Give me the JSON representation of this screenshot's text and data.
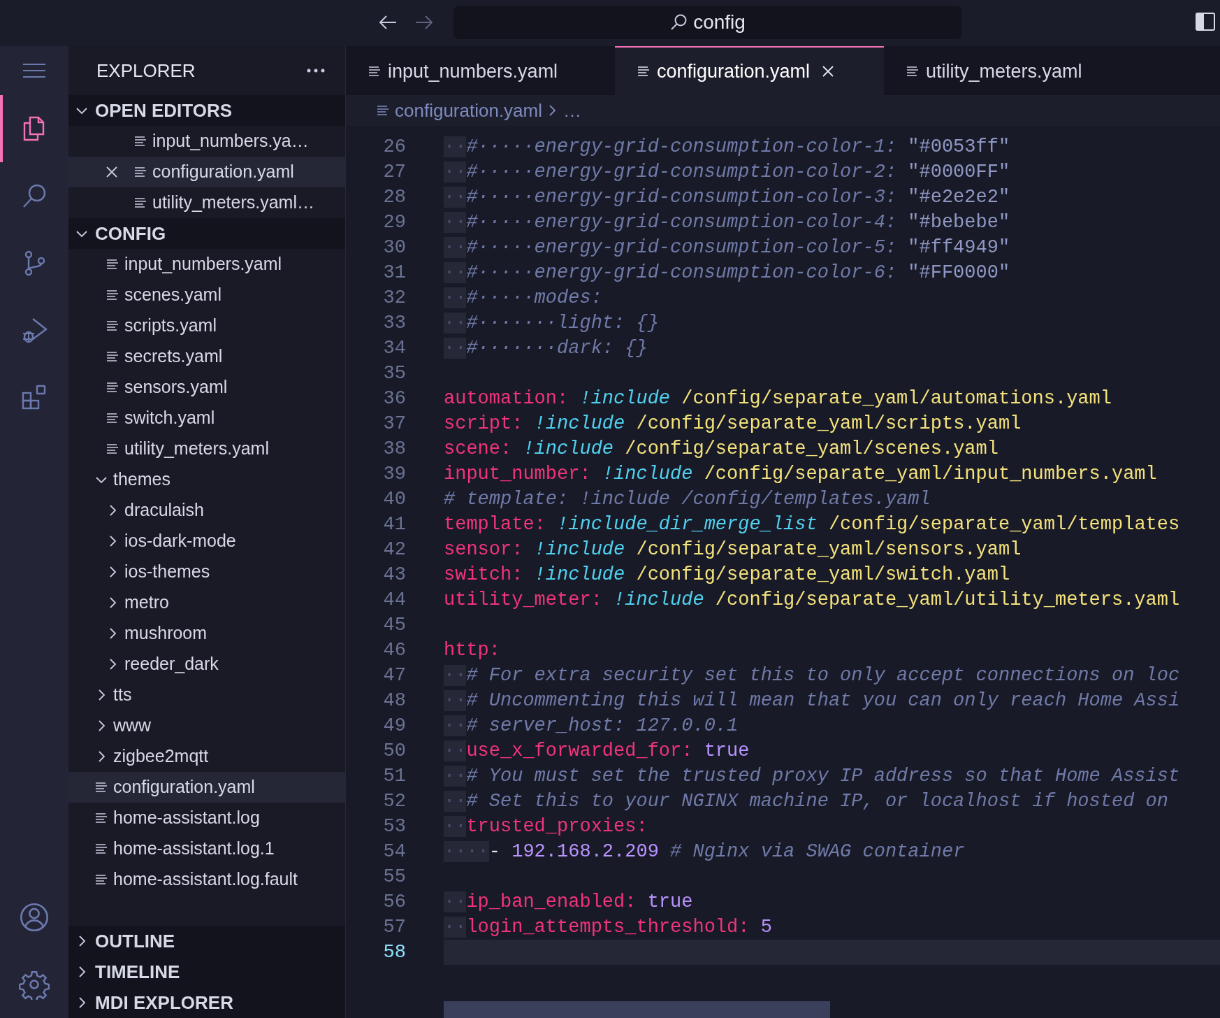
{
  "title_bar": {
    "search": {
      "value": "config"
    }
  },
  "activity_bar": {
    "items": [
      {
        "kind": "files",
        "selected": true
      },
      {
        "kind": "search",
        "selected": false
      },
      {
        "kind": "source-control",
        "selected": false
      },
      {
        "kind": "run-debug",
        "selected": false
      },
      {
        "kind": "extensions",
        "selected": false
      }
    ],
    "bottom": [
      {
        "kind": "account"
      },
      {
        "kind": "settings"
      }
    ]
  },
  "sidebar": {
    "title": "EXPLORER",
    "sections": [
      {
        "kind": "open_editors",
        "title": "OPEN EDITORS",
        "expanded": true,
        "items": [
          {
            "label": "input_numbers.ya…",
            "selected": false
          },
          {
            "label": "configuration.yaml",
            "selected": true
          },
          {
            "label": "utility_meters.yaml…",
            "selected": false
          }
        ]
      },
      {
        "kind": "tree",
        "title": "CONFIG",
        "expanded": true,
        "items": [
          {
            "kind": "group",
            "children": [
              {
                "kind": "file",
                "label": "input_numbers.yaml",
                "selected": false
              },
              {
                "kind": "file",
                "label": "scenes.yaml",
                "selected": false
              },
              {
                "kind": "file",
                "label": "scripts.yaml",
                "selected": false
              },
              {
                "kind": "file",
                "label": "secrets.yaml",
                "selected": false
              },
              {
                "kind": "file",
                "label": "sensors.yaml",
                "selected": false
              },
              {
                "kind": "file",
                "label": "switch.yaml",
                "selected": false
              },
              {
                "kind": "file",
                "label": "utility_meters.yaml",
                "selected": false
              }
            ]
          },
          {
            "kind": "folder",
            "label": "themes",
            "expanded": true,
            "children": [
              {
                "kind": "folder",
                "label": "draculaish",
                "expanded": false
              },
              {
                "kind": "folder",
                "label": "ios-dark-mode",
                "expanded": false
              },
              {
                "kind": "folder",
                "label": "ios-themes",
                "expanded": false
              },
              {
                "kind": "folder",
                "label": "metro",
                "expanded": false
              },
              {
                "kind": "folder",
                "label": "mushroom",
                "expanded": false
              },
              {
                "kind": "folder",
                "label": "reeder_dark",
                "expanded": false
              }
            ]
          },
          {
            "kind": "folder",
            "label": "tts",
            "expanded": false
          },
          {
            "kind": "folder",
            "label": "www",
            "expanded": false
          },
          {
            "kind": "folder",
            "label": "zigbee2mqtt",
            "expanded": false
          },
          {
            "kind": "file",
            "label": "configuration.yaml",
            "selected": true
          },
          {
            "kind": "file",
            "label": "home-assistant.log",
            "selected": false
          },
          {
            "kind": "file",
            "label": "home-assistant.log.1",
            "selected": false
          },
          {
            "kind": "file",
            "label": "home-assistant.log.fault",
            "selected": false
          }
        ]
      },
      {
        "kind": "collapsed",
        "title": "OUTLINE",
        "expanded": false
      },
      {
        "kind": "collapsed",
        "title": "TIMELINE",
        "expanded": false
      },
      {
        "kind": "collapsed",
        "title": "MDI EXPLORER",
        "expanded": false
      }
    ]
  },
  "editor": {
    "tabs": [
      {
        "label": "input_numbers.yaml",
        "selected": false
      },
      {
        "label": "configuration.yaml",
        "selected": true
      },
      {
        "label": "utility_meters.yaml",
        "selected": false
      }
    ],
    "breadcrumb": [
      "configuration.yaml",
      "…"
    ],
    "lines": [
      {
        "number": "26",
        "current": false,
        "tokens": [
          {
            "kind": "ws",
            "text": "··"
          },
          {
            "kind": "comment",
            "text": "#·····energy-grid-consumption-color-1:"
          },
          {
            "kind": "cstr",
            "text": " \"#0053ff\""
          }
        ]
      },
      {
        "number": "27",
        "current": false,
        "tokens": [
          {
            "kind": "ws",
            "text": "··"
          },
          {
            "kind": "comment",
            "text": "#·····energy-grid-consumption-color-2:"
          },
          {
            "kind": "cstr",
            "text": " \"#0000FF\""
          }
        ]
      },
      {
        "number": "28",
        "current": false,
        "tokens": [
          {
            "kind": "ws",
            "text": "··"
          },
          {
            "kind": "comment",
            "text": "#·····energy-grid-consumption-color-3:"
          },
          {
            "kind": "cstr",
            "text": " \"#e2e2e2\""
          }
        ]
      },
      {
        "number": "29",
        "current": false,
        "tokens": [
          {
            "kind": "ws",
            "text": "··"
          },
          {
            "kind": "comment",
            "text": "#·····energy-grid-consumption-color-4:"
          },
          {
            "kind": "cstr",
            "text": " \"#bebebe\""
          }
        ]
      },
      {
        "number": "30",
        "current": false,
        "tokens": [
          {
            "kind": "ws",
            "text": "··"
          },
          {
            "kind": "comment",
            "text": "#·····energy-grid-consumption-color-5:"
          },
          {
            "kind": "cstr",
            "text": " \"#ff4949\""
          }
        ]
      },
      {
        "number": "31",
        "current": false,
        "tokens": [
          {
            "kind": "ws",
            "text": "··"
          },
          {
            "kind": "comment",
            "text": "#·····energy-grid-consumption-color-6:"
          },
          {
            "kind": "cstr",
            "text": " \"#FF0000\""
          }
        ]
      },
      {
        "number": "32",
        "current": false,
        "tokens": [
          {
            "kind": "ws",
            "text": "··"
          },
          {
            "kind": "comment",
            "text": "#·····modes:"
          }
        ]
      },
      {
        "number": "33",
        "current": false,
        "tokens": [
          {
            "kind": "ws",
            "text": "··"
          },
          {
            "kind": "comment",
            "text": "#·······light: {}"
          }
        ]
      },
      {
        "number": "34",
        "current": false,
        "tokens": [
          {
            "kind": "ws",
            "text": "··"
          },
          {
            "kind": "comment",
            "text": "#·······dark: {}"
          }
        ]
      },
      {
        "number": "35",
        "current": false
      },
      {
        "number": "36",
        "current": false,
        "tokens": [
          {
            "kind": "key",
            "text": "automation:"
          },
          {
            "kind": "tag",
            "text": " !include"
          },
          {
            "kind": "path",
            "text": " /config/separate_yaml/automations.yaml"
          }
        ]
      },
      {
        "number": "37",
        "current": false,
        "tokens": [
          {
            "kind": "key",
            "text": "script:"
          },
          {
            "kind": "tag",
            "text": " !include"
          },
          {
            "kind": "path",
            "text": " /config/separate_yaml/scripts.yaml"
          }
        ]
      },
      {
        "number": "38",
        "current": false,
        "tokens": [
          {
            "kind": "key",
            "text": "scene:"
          },
          {
            "kind": "tag",
            "text": " !include"
          },
          {
            "kind": "path",
            "text": " /config/separate_yaml/scenes.yaml"
          }
        ]
      },
      {
        "number": "39",
        "current": false,
        "tokens": [
          {
            "kind": "key",
            "text": "input_number:"
          },
          {
            "kind": "tag",
            "text": " !include"
          },
          {
            "kind": "path",
            "text": " /config/separate_yaml/input_numbers.yaml"
          }
        ]
      },
      {
        "number": "40",
        "current": false,
        "tokens": [
          {
            "kind": "comment",
            "text": "# template: !include /config/templates.yaml"
          }
        ]
      },
      {
        "number": "41",
        "current": false,
        "tokens": [
          {
            "kind": "key",
            "text": "template:"
          },
          {
            "kind": "tag",
            "text": " !include_dir_merge_list"
          },
          {
            "kind": "path",
            "text": " /config/separate_yaml/templates"
          }
        ]
      },
      {
        "number": "42",
        "current": false,
        "tokens": [
          {
            "kind": "key",
            "text": "sensor:"
          },
          {
            "kind": "tag",
            "text": " !include"
          },
          {
            "kind": "path",
            "text": " /config/separate_yaml/sensors.yaml"
          }
        ]
      },
      {
        "number": "43",
        "current": false,
        "tokens": [
          {
            "kind": "key",
            "text": "switch:"
          },
          {
            "kind": "tag",
            "text": " !include"
          },
          {
            "kind": "path",
            "text": " /config/separate_yaml/switch.yaml"
          }
        ]
      },
      {
        "number": "44",
        "current": false,
        "tokens": [
          {
            "kind": "key",
            "text": "utility_meter:"
          },
          {
            "kind": "tag",
            "text": " !include"
          },
          {
            "kind": "path",
            "text": " /config/separate_yaml/utility_meters.yaml"
          }
        ]
      },
      {
        "number": "45",
        "current": false
      },
      {
        "number": "46",
        "current": false,
        "tokens": [
          {
            "kind": "key",
            "text": "http:"
          }
        ]
      },
      {
        "number": "47",
        "current": false,
        "tokens": [
          {
            "kind": "ws",
            "text": "··"
          },
          {
            "kind": "comment",
            "text": "# For extra security set this to only accept connections on loc"
          }
        ]
      },
      {
        "number": "48",
        "current": false,
        "tokens": [
          {
            "kind": "ws",
            "text": "··"
          },
          {
            "kind": "comment",
            "text": "# Uncommenting this will mean that you can only reach Home Assi"
          }
        ]
      },
      {
        "number": "49",
        "current": false,
        "tokens": [
          {
            "kind": "ws",
            "text": "··"
          },
          {
            "kind": "comment",
            "text": "# server_host: 127.0.0.1"
          }
        ]
      },
      {
        "number": "50",
        "current": false,
        "tokens": [
          {
            "kind": "ws",
            "text": "··"
          },
          {
            "kind": "key",
            "text": "use_x_forwarded_for:"
          },
          {
            "kind": "value",
            "text": " true"
          }
        ]
      },
      {
        "number": "51",
        "current": false,
        "tokens": [
          {
            "kind": "ws",
            "text": "··"
          },
          {
            "kind": "comment",
            "text": "# You must set the trusted proxy IP address so that Home Assist"
          }
        ]
      },
      {
        "number": "52",
        "current": false,
        "tokens": [
          {
            "kind": "ws",
            "text": "··"
          },
          {
            "kind": "comment",
            "text": "# Set this to your NGINX machine IP, or localhost if hosted on"
          }
        ]
      },
      {
        "number": "53",
        "current": false,
        "tokens": [
          {
            "kind": "ws",
            "text": "··"
          },
          {
            "kind": "key",
            "text": "trusted_proxies:"
          }
        ]
      },
      {
        "number": "54",
        "current": false,
        "tokens": [
          {
            "kind": "ws",
            "text": "····"
          },
          {
            "kind": "plain",
            "text": "- "
          },
          {
            "kind": "value",
            "text": "192.168.2.209"
          },
          {
            "kind": "comment",
            "text": " # Nginx via SWAG container"
          }
        ]
      },
      {
        "number": "55",
        "current": false
      },
      {
        "number": "56",
        "current": false,
        "tokens": [
          {
            "kind": "ws",
            "text": "··"
          },
          {
            "kind": "key",
            "text": "ip_ban_enabled:"
          },
          {
            "kind": "value",
            "text": " true"
          }
        ]
      },
      {
        "number": "57",
        "current": false,
        "tokens": [
          {
            "kind": "ws",
            "text": "··"
          },
          {
            "kind": "key",
            "text": "login_attempts_threshold:"
          },
          {
            "kind": "value",
            "text": " 5"
          }
        ]
      },
      {
        "number": "58",
        "current": true
      }
    ]
  }
}
